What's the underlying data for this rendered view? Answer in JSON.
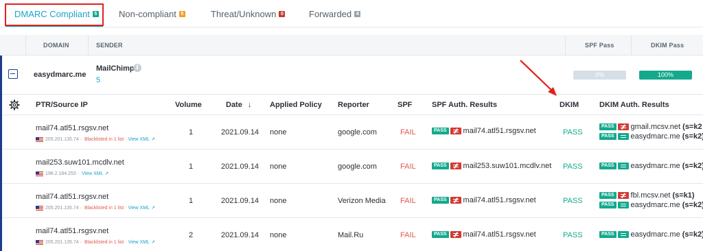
{
  "tabs": [
    {
      "label": "DMARC Compliant",
      "count": "5",
      "badge_color": "#14a98c",
      "active": true
    },
    {
      "label": "Non-compliant",
      "count": "5",
      "badge_color": "#f39c2b",
      "active": false
    },
    {
      "label": "Threat/Unknown",
      "count": "0",
      "badge_color": "#c0392b",
      "active": false
    },
    {
      "label": "Forwarded",
      "count": "4",
      "badge_color": "#9aa3ab",
      "active": false
    }
  ],
  "table_header": {
    "domain": "DOMAIN",
    "sender": "SENDER",
    "spf_pass": "SPF Pass",
    "dkim_pass": "DKIM Pass"
  },
  "group": {
    "domain": "easydmarc.me",
    "sender": "MailChimp",
    "sender_count": "5",
    "spf_pass_pct": "0%",
    "dkim_pass_pct": "100%"
  },
  "sub_header": {
    "ptr": "PTR/Source IP",
    "volume": "Volume",
    "date": "Date",
    "applied_policy": "Applied Policy",
    "reporter": "Reporter",
    "spf": "SPF",
    "spf_auth": "SPF Auth. Results",
    "dkim": "DKIM",
    "dkim_auth": "DKIM Auth. Results"
  },
  "chip_labels": {
    "pass": "PASS"
  },
  "rows": [
    {
      "ptr": "mail74.atl51.rsgsv.net",
      "ip": "205.201.135.74",
      "blacklist": "Blacklisted in 1 list",
      "view_xml": "View XML",
      "volume": "1",
      "date": "2021.09.14",
      "policy": "none",
      "reporter": "google.com",
      "spf": "FAIL",
      "spf_auth_domain": "mail74.atl51.rsgsv.net",
      "dkim": "PASS",
      "dkim_auth": [
        {
          "domain": "gmail.mcsv.net",
          "selector": "(s=k2",
          "aligned": false
        },
        {
          "domain": "easydmarc.me",
          "selector": "(s=k2)",
          "aligned": true
        }
      ]
    },
    {
      "ptr": "mail253.suw101.mcdlv.net",
      "ip": "198.2.184.253",
      "blacklist": "",
      "view_xml": "View XML",
      "volume": "1",
      "date": "2021.09.14",
      "policy": "none",
      "reporter": "google.com",
      "spf": "FAIL",
      "spf_auth_domain": "mail253.suw101.mcdlv.net",
      "dkim": "PASS",
      "dkim_auth": [
        {
          "domain": "easydmarc.me",
          "selector": "(s=k2)",
          "aligned": true
        }
      ]
    },
    {
      "ptr": "mail74.atl51.rsgsv.net",
      "ip": "205.201.135.74",
      "blacklist": "Blacklisted in 1 list",
      "view_xml": "View XML",
      "volume": "1",
      "date": "2021.09.14",
      "policy": "none",
      "reporter": "Verizon Media",
      "spf": "FAIL",
      "spf_auth_domain": "mail74.atl51.rsgsv.net",
      "dkim": "PASS",
      "dkim_auth": [
        {
          "domain": "fbl.mcsv.net",
          "selector": "(s=k1)",
          "aligned": false
        },
        {
          "domain": "easydmarc.me",
          "selector": "(s=k2)",
          "aligned": true
        }
      ]
    },
    {
      "ptr": "mail74.atl51.rsgsv.net",
      "ip": "205.201.135.74",
      "blacklist": "Blacklisted in 1 list",
      "view_xml": "View XML",
      "volume": "2",
      "date": "2021.09.14",
      "policy": "none",
      "reporter": "Mail.Ru",
      "spf": "FAIL",
      "spf_auth_domain": "mail74.atl51.rsgsv.net",
      "dkim": "PASS",
      "dkim_auth": [
        {
          "domain": "easydmarc.me",
          "selector": "(s=k2)",
          "aligned": true
        }
      ]
    }
  ]
}
